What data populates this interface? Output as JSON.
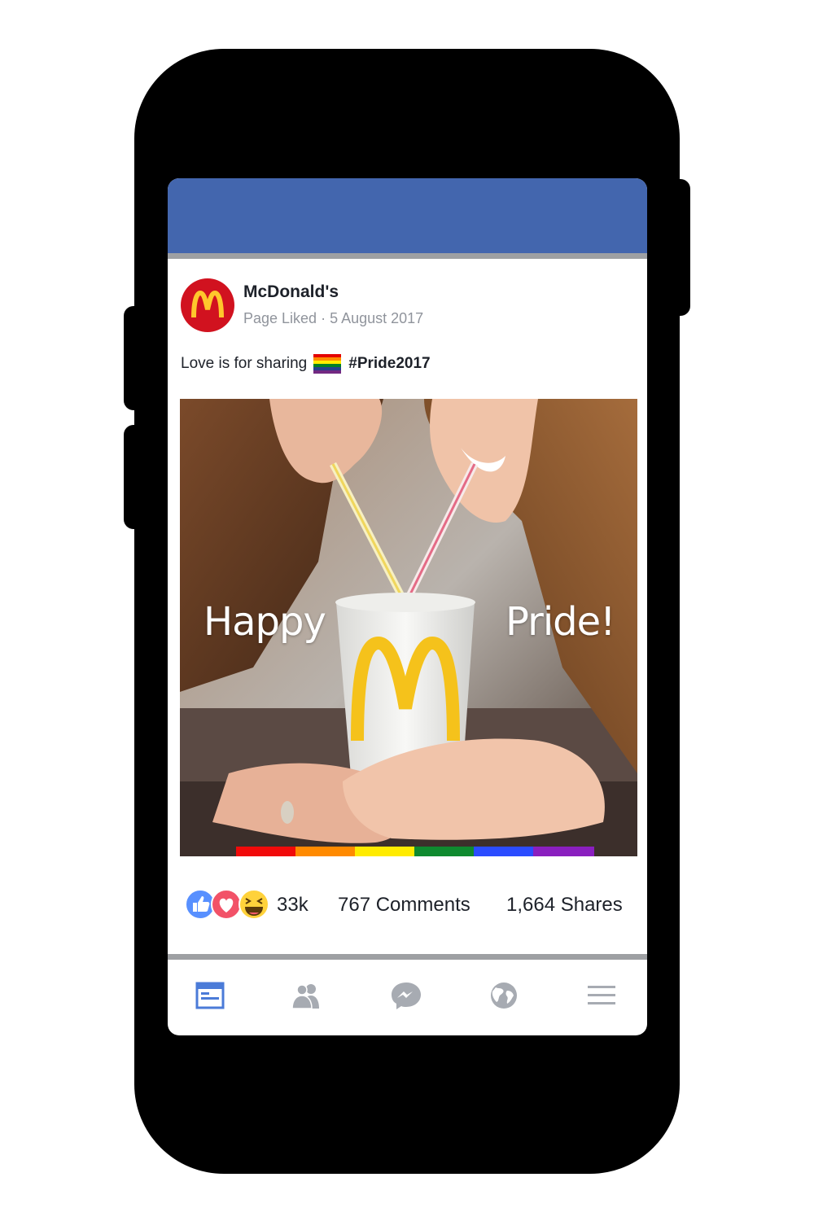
{
  "post": {
    "page_name": "McDonald's",
    "meta": "Page Liked · 5 August 2017",
    "caption_text": "Love is for sharing",
    "hashtag": "#Pride2017"
  },
  "photo": {
    "overlay_left": "Happy",
    "overlay_right": "Pride!"
  },
  "stats": {
    "reactions_count": "33k",
    "comments": "767 Comments",
    "shares": "1,664 Shares"
  },
  "nav": {
    "items": [
      {
        "icon": "news-feed-icon",
        "active": true
      },
      {
        "icon": "friends-icon",
        "active": false
      },
      {
        "icon": "messenger-icon",
        "active": false
      },
      {
        "icon": "globe-icon",
        "active": false
      },
      {
        "icon": "menu-icon",
        "active": false
      }
    ]
  },
  "colors": {
    "facebook_blue": "#4366ae",
    "active_icon": "#4b7bd8",
    "inactive_icon": "#a7abb2",
    "mcdonalds_red": "#d1121f",
    "mcdonalds_yellow": "#ffc72c"
  }
}
